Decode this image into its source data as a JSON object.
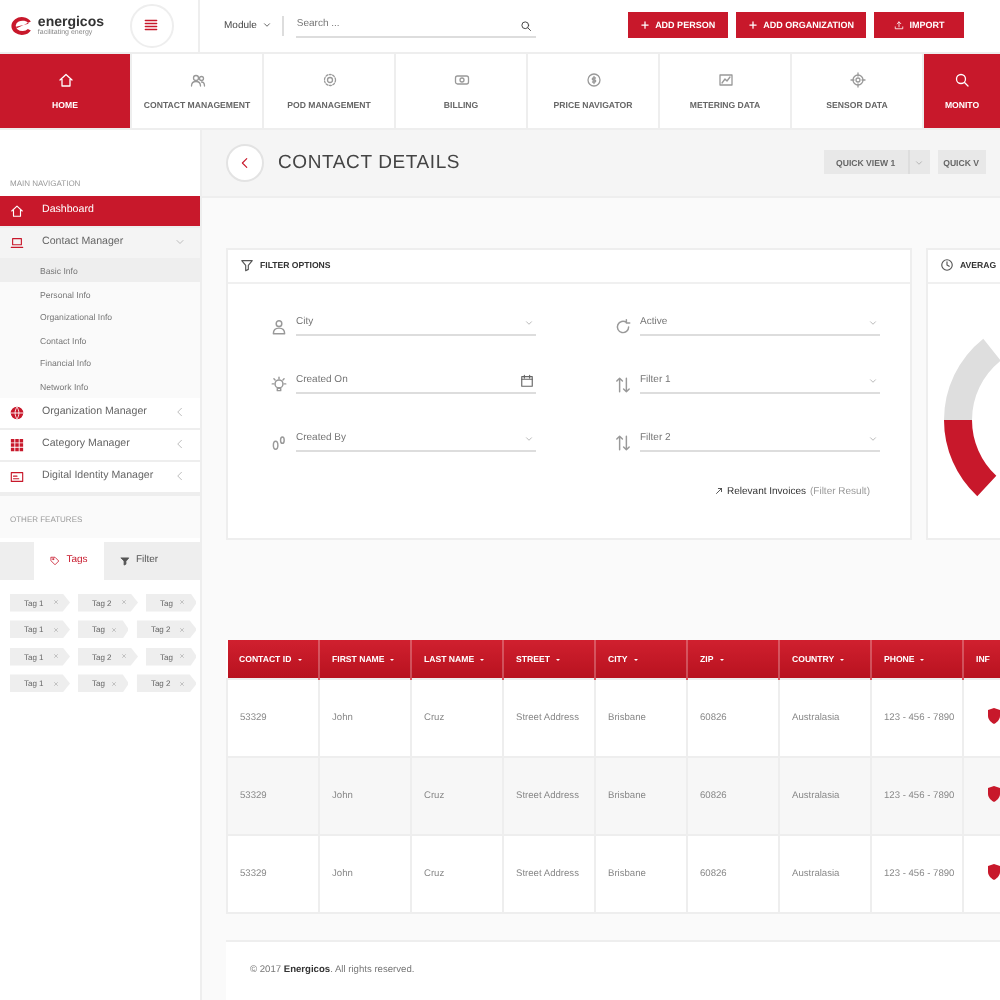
{
  "header": {
    "logo": {
      "name": "energicos",
      "tagline": "facilitating energy"
    },
    "module_select": {
      "value": "Module"
    },
    "search": {
      "placeholder": "Search ..."
    },
    "buttons": [
      {
        "label": "ADD PERSON"
      },
      {
        "label": "ADD ORGANIZATION"
      },
      {
        "label": "IMPORT"
      }
    ]
  },
  "nav_tabs": [
    {
      "label": "HOME",
      "selected": true
    },
    {
      "label": "CONTACT MANAGEMENT",
      "selected": false
    },
    {
      "label": "POD MANAGEMENT",
      "selected": false
    },
    {
      "label": "BILLING",
      "selected": false
    },
    {
      "label": "PRICE NAVIGATOR",
      "selected": false
    },
    {
      "label": "METERING DATA",
      "selected": false
    },
    {
      "label": "SENSOR DATA",
      "selected": false
    },
    {
      "label": "MONITO",
      "selected": true
    }
  ],
  "sidebar": {
    "sections": [
      {
        "title": "MAIN NAVIGATION",
        "items": [
          {
            "label": "Dashboard",
            "selected": true
          },
          {
            "label": "Contact Manager",
            "selected": false,
            "expanded": true,
            "children": [
              {
                "label": "Basic Info",
                "selected": true
              },
              {
                "label": "Personal Info",
                "selected": false
              },
              {
                "label": "Organizational Info",
                "selected": false
              },
              {
                "label": "Contact Info",
                "selected": false
              },
              {
                "label": "Financial Info",
                "selected": false
              },
              {
                "label": "Network Info",
                "selected": false
              }
            ]
          },
          {
            "label": "Organization Manager",
            "selected": false,
            "expanded": false
          },
          {
            "label": "Category Manager",
            "selected": false,
            "expanded": false
          },
          {
            "label": "Digital Identity Manager",
            "selected": false,
            "expanded": false
          }
        ]
      },
      {
        "title": "OTHER FEATURES"
      }
    ],
    "feature_tabs": [
      {
        "label": "Tags",
        "selected": true
      },
      {
        "label": "Filter",
        "selected": false
      }
    ],
    "tag_rows": [
      [
        "Tag 1",
        "Tag 2",
        "Tag"
      ],
      [
        "Tag 1",
        "Tag",
        "Tag 2"
      ],
      [
        "Tag 1",
        "Tag 2",
        "Tag"
      ],
      [
        "Tag 1",
        "Tag",
        "Tag 2"
      ]
    ]
  },
  "page": {
    "title": "CONTACT DETAILS",
    "quick_views": [
      {
        "label": "QUICK VIEW 1",
        "kind": "split"
      },
      {
        "label": "QUICK V",
        "kind": "plain"
      }
    ]
  },
  "filter_card": {
    "title": "FILTER OPTIONS",
    "fields": [
      {
        "placeholder": "City",
        "kind": "dropdown"
      },
      {
        "placeholder": "Active",
        "kind": "dropdown"
      },
      {
        "placeholder": "Created On",
        "kind": "date"
      },
      {
        "placeholder": "Filter 1",
        "kind": "dropdown"
      },
      {
        "placeholder": "Created By",
        "kind": "dropdown"
      },
      {
        "placeholder": "Filter 2",
        "kind": "dropdown"
      }
    ],
    "link": {
      "label": "Relevant Invoices",
      "note": "(Filter Result)"
    }
  },
  "side_card": {
    "title": "AVERAG"
  },
  "table": {
    "columns": [
      "CONTACT ID",
      "FIRST NAME",
      "LAST NAME",
      "STREET",
      "CITY",
      "ZIP",
      "COUNTRY",
      "PHONE",
      "INF"
    ],
    "rows": [
      [
        "53329",
        "John",
        "Cruz",
        "Street Address",
        "Brisbane",
        "60826",
        "Australasia",
        "123 - 456 - 7890"
      ],
      [
        "53329",
        "John",
        "Cruz",
        "Street Address",
        "Brisbane",
        "60826",
        "Australasia",
        "123 - 456 - 7890"
      ],
      [
        "53329",
        "John",
        "Cruz",
        "Street Address",
        "Brisbane",
        "60826",
        "Australasia",
        "123 - 456 - 7890"
      ]
    ]
  },
  "footer": {
    "text": "© 2017 **Energicos**. All rights reserved."
  }
}
